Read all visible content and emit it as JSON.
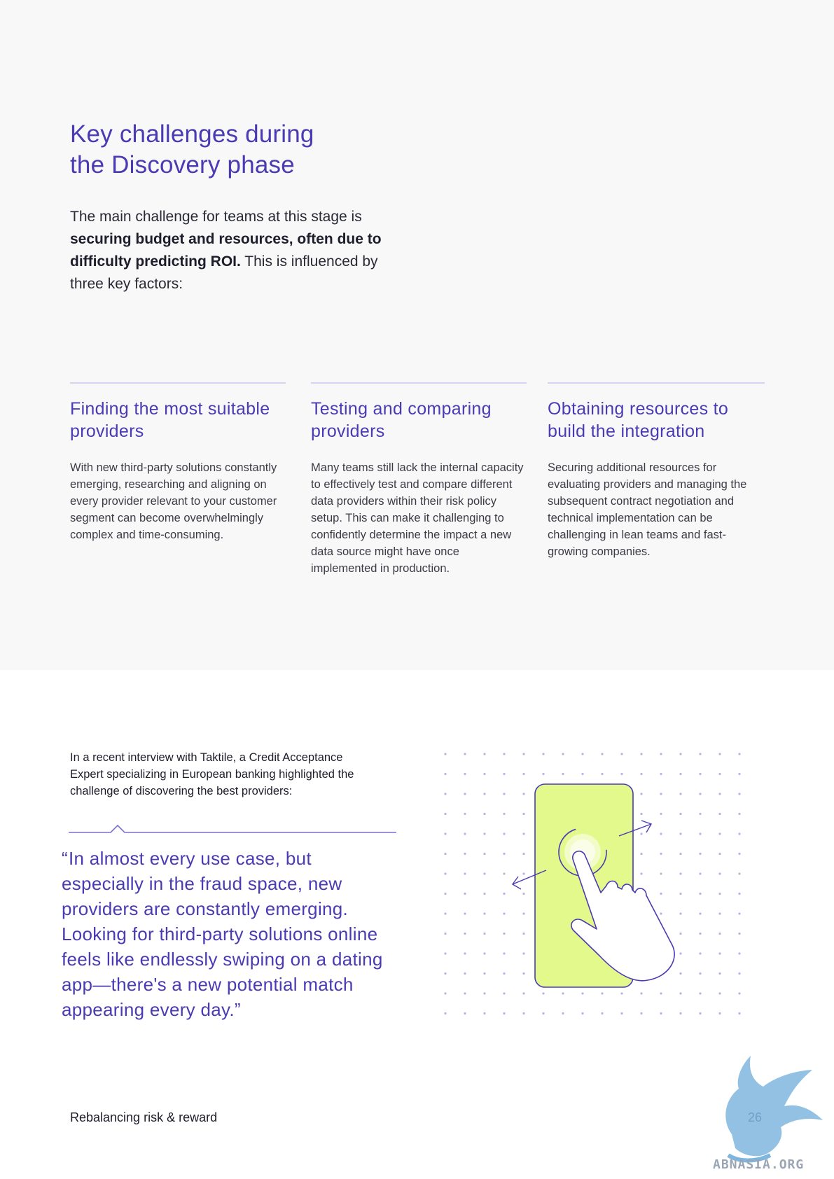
{
  "heading": {
    "line1": "Key challenges during",
    "line2": "the Discovery phase"
  },
  "intro": {
    "part1": "The main challenge for teams at this stage is ",
    "bold": "securing budget and resources, often due to difficulty predicting ROI.",
    "part2": " This is influenced by three key factors:"
  },
  "factors": [
    {
      "title": "Finding the most suitable providers",
      "body": "With new third-party solutions constantly emerging, researching and aligning on every provider relevant to your customer segment can become overwhelmingly complex and time-consuming."
    },
    {
      "title": "Testing and comparing providers",
      "body": "Many teams still lack the internal capacity to effectively test and compare different data providers within their risk policy setup. This can make it challenging to confidently determine the impact a new data source might have once implemented in production."
    },
    {
      "title": "Obtaining resources to build the integration",
      "body": "Securing additional resources for evaluating providers and managing the subsequent contract negotiation and technical implementation can be challenging in lean teams and fast-growing companies."
    }
  ],
  "interview": {
    "text": "In a recent interview with Taktile, a Credit Acceptance Expert specializing in European banking highlighted the challenge of discovering the best providers:"
  },
  "quote": {
    "open_mark": "“",
    "text": "In almost every use case, but especially in the fraud space, new providers are constantly emerging. Looking for third-party solutions online feels like endlessly swiping on a dating app—there's a new potential match appearing every day.”"
  },
  "footer": {
    "title": "Rebalancing risk & reward",
    "page": "26"
  },
  "watermark": {
    "text": "ABNASIA.ORG"
  },
  "colors": {
    "accent": "#4a3bb4",
    "background_top": "#f8f8f9",
    "phone_fill": "#e4f98c",
    "rule": "#d6d3f2"
  },
  "icons": {
    "illustration": "phone-swipe-hand-icon",
    "watermark": "griffin-logo-icon"
  }
}
